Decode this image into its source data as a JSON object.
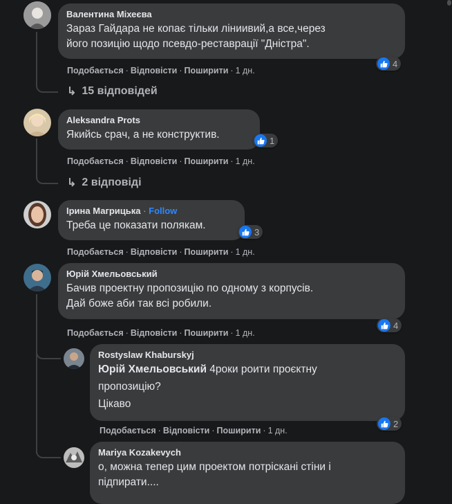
{
  "actions": {
    "like": "Подобається",
    "reply": "Відповісти",
    "share": "Поширити",
    "sep": "·"
  },
  "comments": [
    {
      "author": "Валентина Міхеєва",
      "text_lines": [
        "Зараз Гайдара не копає тільки ліниивий,а все,через",
        "його позицію щодо псевдо-реставрації \"Дністра\"."
      ],
      "time": "1 дн.",
      "reactions": "4",
      "replies_label": "15 відповідей"
    },
    {
      "author": "Aleksandra Prots",
      "text_lines": [
        "Якийсь срач, а не конструктив."
      ],
      "time": "1 дн.",
      "reactions": "1",
      "replies_label": "2 відповіді"
    },
    {
      "author": "Ірина Магрицька",
      "follow": "Follow",
      "text_lines": [
        "Треба це показати полякам."
      ],
      "time": "1 дн.",
      "reactions": "3"
    },
    {
      "author": "Юрій Хмельовський",
      "text_lines": [
        "Бачив проектну пропозицію по одному з корпусів.",
        "Дай боже аби так всі робили."
      ],
      "time": "1 дн.",
      "reactions": "4",
      "replies": [
        {
          "author": "Rostyslaw Khaburskyj",
          "mention": "Юрій Хмельовський",
          "text_after_mention": " 4роки роити проєктну",
          "text_lines": [
            "пропозицію?",
            "Цікаво"
          ],
          "time": "1 дн.",
          "reactions": "2"
        },
        {
          "author": "Mariya Kozakevych",
          "text_lines": [
            "о, можна тепер цим проектом потріскані стіни і",
            "підпирати...."
          ]
        }
      ]
    }
  ],
  "icons": {
    "like": "thumbs-up-icon",
    "reply_arrow": "reply-arrow-icon"
  },
  "colors": {
    "like_blue": "#1877f2",
    "follow_blue": "#2d88ff",
    "bubble": "#3a3b3c",
    "background": "#18191a"
  }
}
